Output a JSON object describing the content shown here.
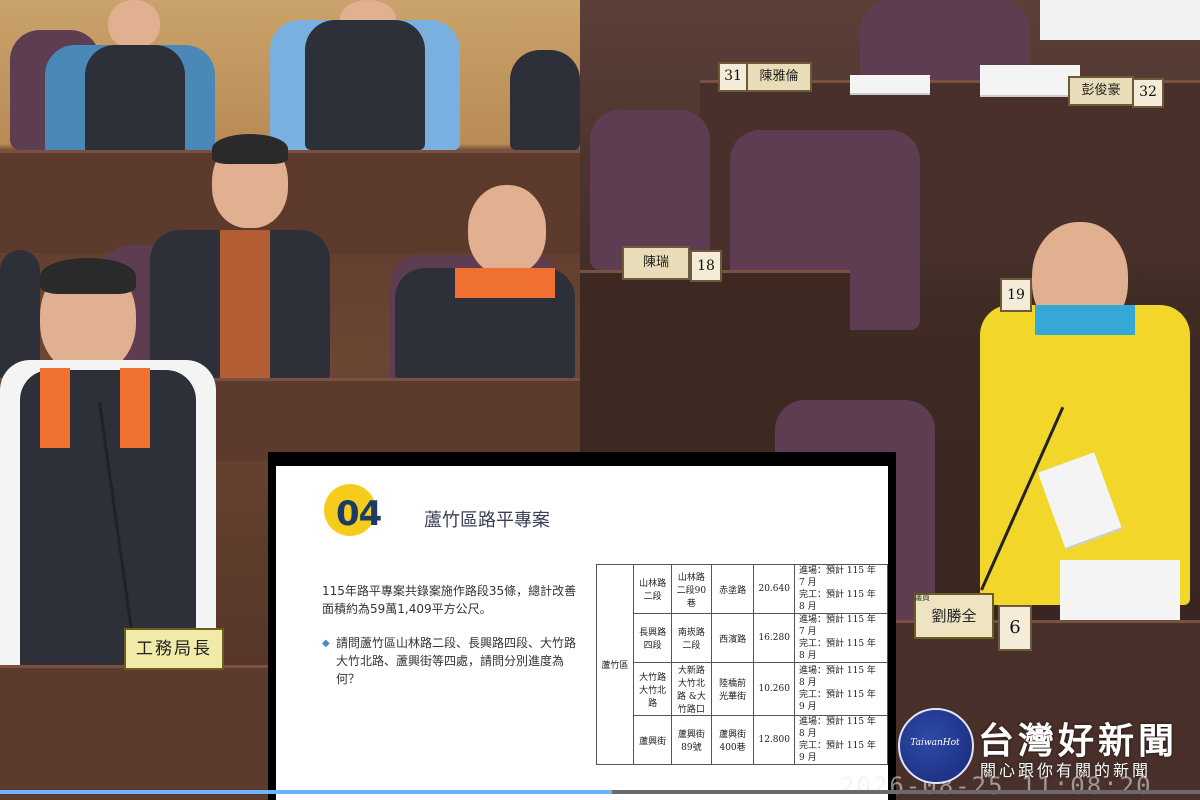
{
  "left_photo": {
    "director_plate": "工務局長"
  },
  "right_photo": {
    "councilor_plate_small": "議員",
    "councilor_plate": "劉勝全",
    "seat_numbers": [
      "31",
      "32",
      "18",
      "19",
      "6"
    ],
    "name_plates": [
      "陳雅倫",
      "彭俊豪",
      "陳瑞"
    ]
  },
  "slide": {
    "number": "04",
    "title": "蘆竹區路平專案",
    "paragraph": "115年路平專案共錄案施作路段35條，總計改善面積約為59萬1,409平方公尺。",
    "question": "請問蘆竹區山林路二段、長興路四段、大竹路大竹北路、蘆興街等四處，請問分別進度為何？",
    "table": {
      "district": "蘆竹區",
      "rows": [
        {
          "road": "山林路二段",
          "section": "山林路二段90巷",
          "to": "赤塗路",
          "area": "20.640",
          "start": "進場：預計 115 年 7 月",
          "end": "完工：預計 115 年 8 月"
        },
        {
          "road": "長興路四段",
          "section": "南崁路二段",
          "to": "西濱路",
          "area": "16.280",
          "start": "進場：預計 115 年 7 月",
          "end": "完工：預計 115 年 8 月"
        },
        {
          "road": "大竹路 大竹北路",
          "section": "大新路 大竹北路 &大竹路口",
          "to": "陸橋前 光華街",
          "area": "10.260",
          "start": "進場：預計 115 年 8 月",
          "end": "完工：預計 115 年 9 月"
        },
        {
          "road": "蘆興街",
          "section": "蘆興街89號",
          "to": "蘆興街400巷",
          "area": "12.800",
          "start": "進場：預計 115 年 8 月",
          "end": "完工：預計 115 年 9 月"
        }
      ]
    }
  },
  "overlay": {
    "timestamp": "2026-08-25 11:08:20",
    "progress_fraction": 0.51
  },
  "logo": {
    "circle_text": "TaiwanHot",
    "main": "台灣好新聞",
    "sub": "關心跟你有關的新聞"
  }
}
